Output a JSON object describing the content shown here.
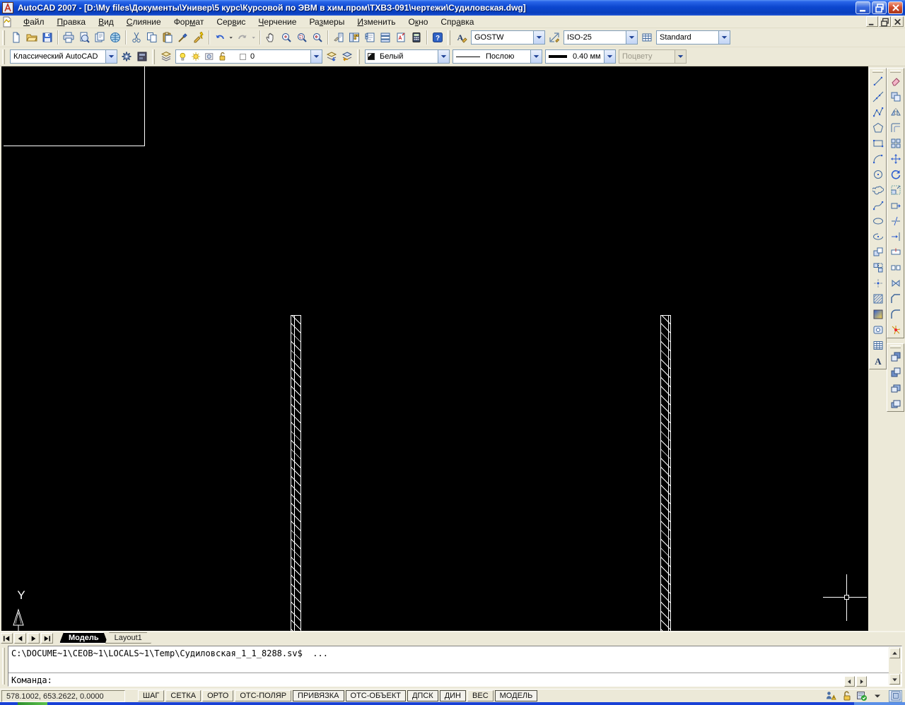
{
  "window": {
    "title": "AutoCAD 2007 - [D:\\My files\\Документы\\Универ\\5 курс\\Курсовой по ЭВМ в хим.пром\\ТХВЗ-091\\чертежи\\Судиловская.dwg]"
  },
  "menu": {
    "items": [
      {
        "label": "Файл",
        "accel": 0
      },
      {
        "label": "Правка",
        "accel": 0
      },
      {
        "label": "Вид",
        "accel": 0
      },
      {
        "label": "Слияние",
        "accel": 0
      },
      {
        "label": "Формат",
        "accel": 3
      },
      {
        "label": "Сервис",
        "accel": 3
      },
      {
        "label": "Черчение",
        "accel": 0
      },
      {
        "label": "Размеры",
        "accel": 2
      },
      {
        "label": "Изменить",
        "accel": 0
      },
      {
        "label": "Окно",
        "accel": 1
      },
      {
        "label": "Справка",
        "accel": 3
      }
    ]
  },
  "toolbars": {
    "standard": {
      "icons": [
        "qnew",
        "open",
        "save",
        "separator",
        "plot",
        "plot-preview",
        "publish",
        "etransmit",
        "separator",
        "cut",
        "copy",
        "paste",
        "match-properties",
        "block-editor",
        "separator",
        "undo",
        "undo-dropdown",
        "redo",
        "redo-dropdown",
        "separator",
        "pan",
        "zoom-realtime",
        "zoom-window",
        "zoom-previous",
        "separator",
        "properties",
        "designcenter",
        "tool-palettes",
        "sheetset-manager",
        "markup-manager",
        "quickcalc",
        "separator",
        "help"
      ]
    },
    "styles": {
      "text_style": "GOSTW",
      "dim_style": "ISO-25",
      "table_style": "Standard"
    },
    "workspaces": {
      "value": "Классический AutoCAD",
      "icons": [
        "workspace-settings",
        "my-workspace"
      ]
    },
    "layers": {
      "current": "0",
      "combo_icons": [
        "bulb",
        "sun",
        "viewport-freeze",
        "lock"
      ],
      "trailing_icons": [
        "make-object-layer-current",
        "layer-previous"
      ]
    },
    "properties": {
      "color": "Белый",
      "linetype": "Послою",
      "lineweight": "0.40 мм",
      "plotstyle": "Поцвету"
    }
  },
  "draw_toolbar": {
    "icons": [
      "line",
      "construction-line",
      "polyline",
      "polygon",
      "rectangle",
      "arc",
      "circle",
      "revision-cloud",
      "spline",
      "ellipse",
      "ellipse-arc",
      "insert-block",
      "make-block",
      "point",
      "hatch",
      "gradient",
      "region",
      "table",
      "multiline-text"
    ]
  },
  "modify_toolbar": {
    "icons": [
      "erase",
      "copy-object",
      "mirror",
      "offset",
      "array",
      "move",
      "rotate",
      "scale",
      "stretch",
      "trim",
      "extend",
      "break-at-point",
      "break",
      "join",
      "chamfer",
      "fillet",
      "explode"
    ]
  },
  "draworder_toolbar": {
    "icons": [
      "bring-to-front",
      "send-to-back",
      "bring-above-objects",
      "send-under-objects"
    ]
  },
  "tabs": {
    "model": "Модель",
    "layout1": "Layout1"
  },
  "command": {
    "history": "C:\\DOCUME~1\\CEOB~1\\LOCALS~1\\Temp\\Судиловская_1_1_8288.sv$  ...",
    "prompt": "Команда:"
  },
  "statusbar": {
    "coords": "578.1002, 653.2622, 0.0000",
    "buttons": [
      {
        "label": "ШАГ",
        "pressed": false
      },
      {
        "label": "СЕТКА",
        "pressed": false
      },
      {
        "label": "ОРТО",
        "pressed": false
      },
      {
        "label": "ОТС-ПОЛЯР",
        "pressed": false
      },
      {
        "label": "ПРИВЯЗКА",
        "pressed": true
      },
      {
        "label": "ОТС-ОБЪЕКТ",
        "pressed": true
      },
      {
        "label": "ДПСК",
        "pressed": true
      },
      {
        "label": "ДИН",
        "pressed": true
      },
      {
        "label": "ВЕС",
        "pressed": false
      },
      {
        "label": "МОДЕЛЬ",
        "pressed": true
      }
    ],
    "tray_icons": [
      "communication-center",
      "unlock",
      "toolbar-check"
    ]
  },
  "colors": {
    "titlebar": "#0c47cf",
    "toolbar_bg": "#ece9d8",
    "canvas": "#000000",
    "drawing_lines": "#ffffff",
    "taskbar_blue": "#1941d6",
    "taskbar_green": "#5dc24d"
  }
}
